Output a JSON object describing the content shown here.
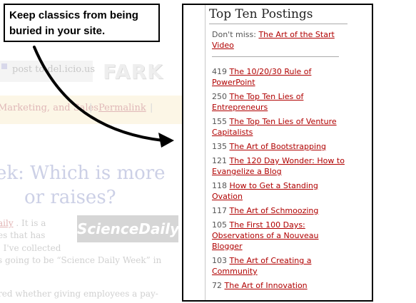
{
  "callout": {
    "line1": "Keep classics from being",
    "line2": "buried in your site."
  },
  "background": {
    "post_label": "post to del.icio.us",
    "fark_logo": "FARK",
    "category_link": "Marketing, and Sales",
    "permalink": "Permalink",
    "headline_line1": "ek: Which is more",
    "headline_line2": "or raises?",
    "sciencedaily_logo": "ScienceDaily",
    "body_lines": [
      {
        "link": "aily",
        "text": "  . It is a"
      },
      {
        "text": "es that has"
      },
      {
        "text": ". I've collected"
      },
      {
        "text": "s going to be “Science Daily Week” in"
      },
      {
        "text": "red whether giving employees a pay-"
      }
    ]
  },
  "panel": {
    "title": "Top Ten Postings",
    "dont_miss_label": "Don't miss:",
    "dont_miss_link": "The Art of the Start Video",
    "items": [
      {
        "count": "419",
        "title": "The 10/20/30 Rule of PowerPoint"
      },
      {
        "count": "250",
        "title": "The Top Ten Lies of Entrepreneurs"
      },
      {
        "count": "155",
        "title": "The Top Ten Lies of Venture Capitalists"
      },
      {
        "count": "135",
        "title": "The Art of Bootstrapping"
      },
      {
        "count": "121",
        "title": "The 120 Day Wonder: How to Evangelize a Blog"
      },
      {
        "count": "118",
        "title": "How to Get a Standing Ovation"
      },
      {
        "count": "117",
        "title": "The Art of Schmoozing"
      },
      {
        "count": "105",
        "title": "The First 100 Days: Observations of a Nouveau Blogger"
      },
      {
        "count": "103",
        "title": "The Art of Creating a Community"
      },
      {
        "count": "72",
        "title": "The Art of Innovation"
      }
    ]
  },
  "colors": {
    "link": "#b00000",
    "faded_text": "#d0d0d0",
    "faded_blue": "#ccd0e6"
  }
}
